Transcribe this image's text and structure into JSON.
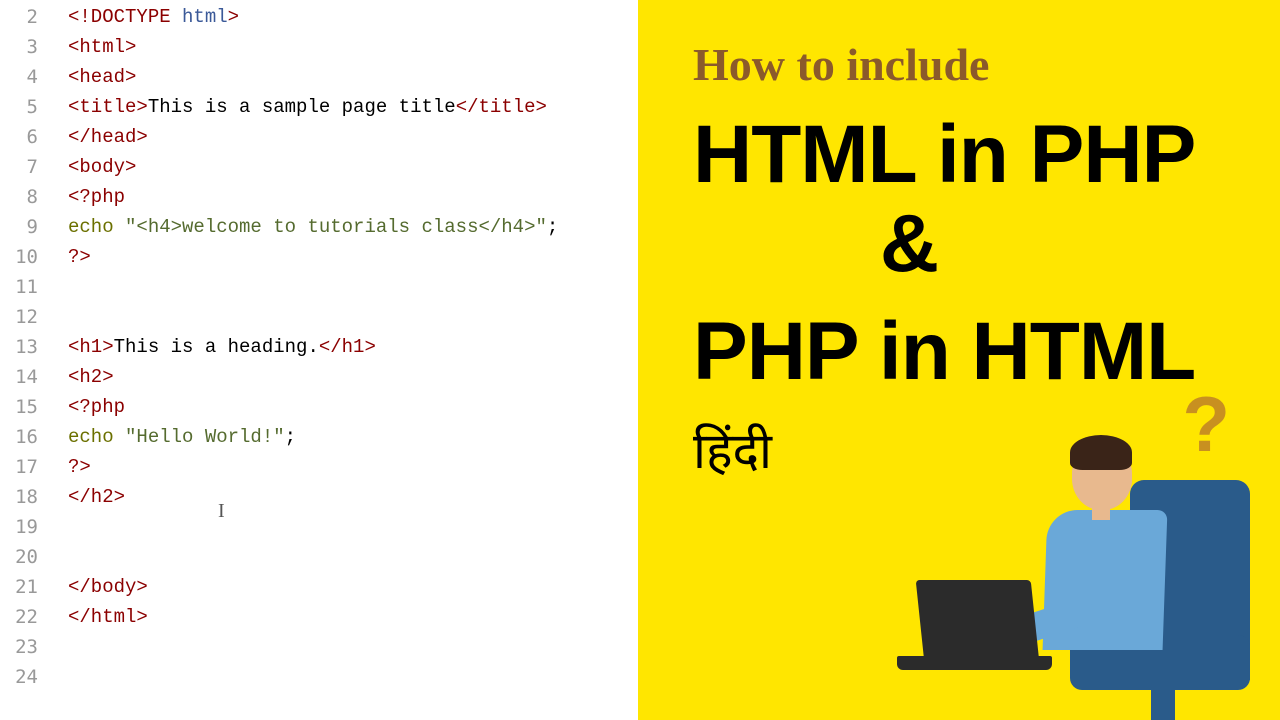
{
  "gutter": [
    "2",
    "3",
    "4",
    "5",
    "6",
    "7",
    "8",
    "9",
    "10",
    "11",
    "12",
    "13",
    "14",
    "15",
    "16",
    "17",
    "18",
    "19",
    "20",
    "21",
    "22",
    "23",
    "24"
  ],
  "code": {
    "l2": {
      "a": "<!DOCTYPE ",
      "b": "html",
      "c": ">"
    },
    "l3": "<html>",
    "l4": "<head>",
    "l5": {
      "a": "<title>",
      "b": "This is a sample page title",
      "c": "</title>"
    },
    "l6": "</head>",
    "l7": "<body>",
    "l8": "<?php",
    "l9": {
      "a": "echo ",
      "b": "\"<h4>welcome to tutorials class</h4>\"",
      "c": ";"
    },
    "l10": "?>",
    "l13": {
      "a": "<h1>",
      "b": "This is a heading.",
      "c": "</h1>"
    },
    "l14": "<h2>",
    "l15": "<?php",
    "l16": {
      "a": "echo ",
      "b": "\"Hello World!\"",
      "c": ";"
    },
    "l17": "?>",
    "l18": "</h2>",
    "l21": "</body>",
    "l22": "</html>"
  },
  "banner": {
    "top": "How to include",
    "line1": "HTML in PHP",
    "amp": "&",
    "line2": "PHP in HTML",
    "hindi": "हिंदी",
    "qmark": "?"
  }
}
